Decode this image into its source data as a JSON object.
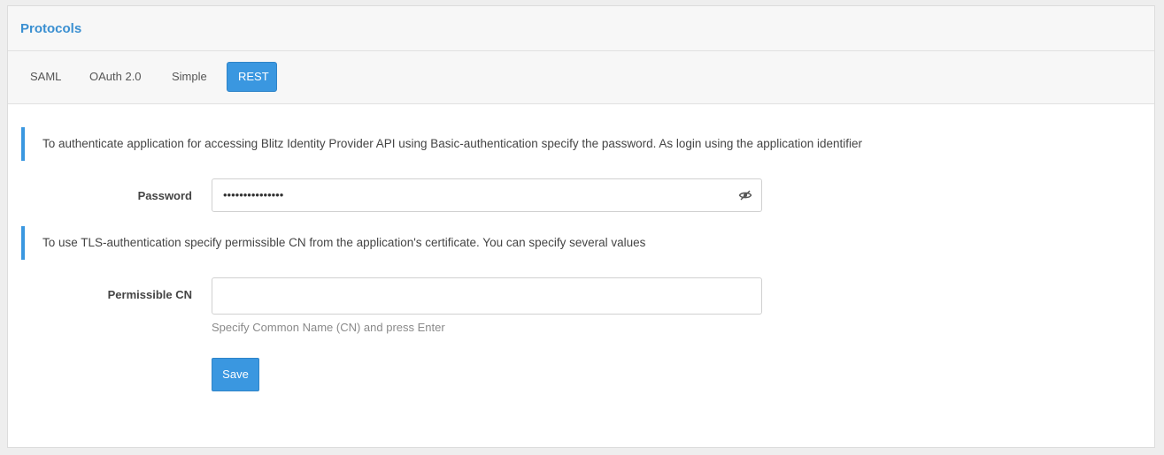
{
  "panel": {
    "title": "Protocols"
  },
  "tabs": [
    {
      "label": "SAML",
      "active": false
    },
    {
      "label": "OAuth 2.0",
      "active": false
    },
    {
      "label": "Simple",
      "active": false
    },
    {
      "label": "REST",
      "active": true
    }
  ],
  "basic_auth": {
    "info": "To authenticate application for accessing Blitz Identity Provider API using Basic-authentication specify the password. As login using the application identifier",
    "password_label": "Password",
    "password_masked": "•••••••••••••••",
    "toggle_icon": "eye-slash-icon"
  },
  "tls_auth": {
    "info": "To use TLS-authentication specify permissible CN from the application's certificate. You can specify several values",
    "cn_label": "Permissible CN",
    "cn_value": "",
    "cn_help": "Specify Common Name (CN) and press Enter"
  },
  "actions": {
    "save_label": "Save"
  },
  "colors": {
    "accent": "#3a97e0",
    "title": "#3a8fd1"
  }
}
